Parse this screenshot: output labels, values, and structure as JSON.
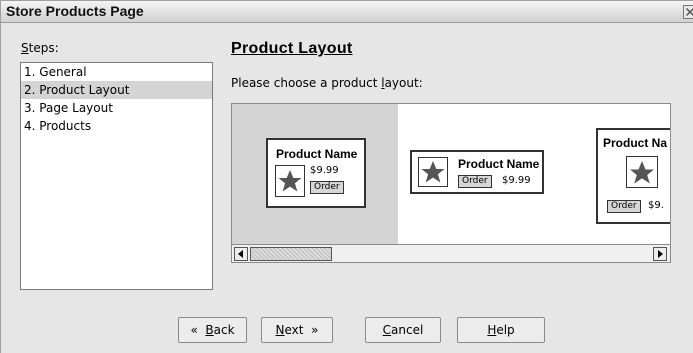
{
  "window": {
    "title": "Store Products Page"
  },
  "steps": {
    "label": "Steps:",
    "label_mnemonic": "S",
    "label_rest": "teps:",
    "items": [
      {
        "label": "1. General",
        "selected": false
      },
      {
        "label": "2. Product Layout",
        "selected": true
      },
      {
        "label": "3. Page Layout",
        "selected": false
      },
      {
        "label": "4. Products",
        "selected": false
      }
    ]
  },
  "main": {
    "heading": "Product Layout",
    "prompt_before": "Please choose a product ",
    "prompt_mnemonic": "l",
    "prompt_after": "ayout:",
    "layouts": [
      {
        "product_name": "Product Name",
        "price": "$9.99",
        "order_label": "Order",
        "selected": true
      },
      {
        "product_name": "Product Name",
        "price": "$9.99",
        "order_label": "Order",
        "selected": false
      },
      {
        "product_name": "Product Na",
        "price": "$9.",
        "order_label": "Order",
        "selected": false
      }
    ]
  },
  "buttons": {
    "back": {
      "arrow": "«",
      "mnemonic": "B",
      "rest": "ack"
    },
    "next": {
      "mnemonic": "N",
      "rest": "ext",
      "arrow": "»"
    },
    "cancel": {
      "mnemonic": "C",
      "rest": "ancel"
    },
    "help": {
      "mnemonic": "H",
      "rest": "elp"
    }
  },
  "icons": {
    "close": "close-icon",
    "star": "star-icon",
    "scroll_left": "arrow-left-icon",
    "scroll_right": "arrow-right-icon"
  },
  "colors": {
    "selected_bg": "#d4d4d4",
    "window_bg": "#e6e6e6",
    "star": "#555555"
  }
}
